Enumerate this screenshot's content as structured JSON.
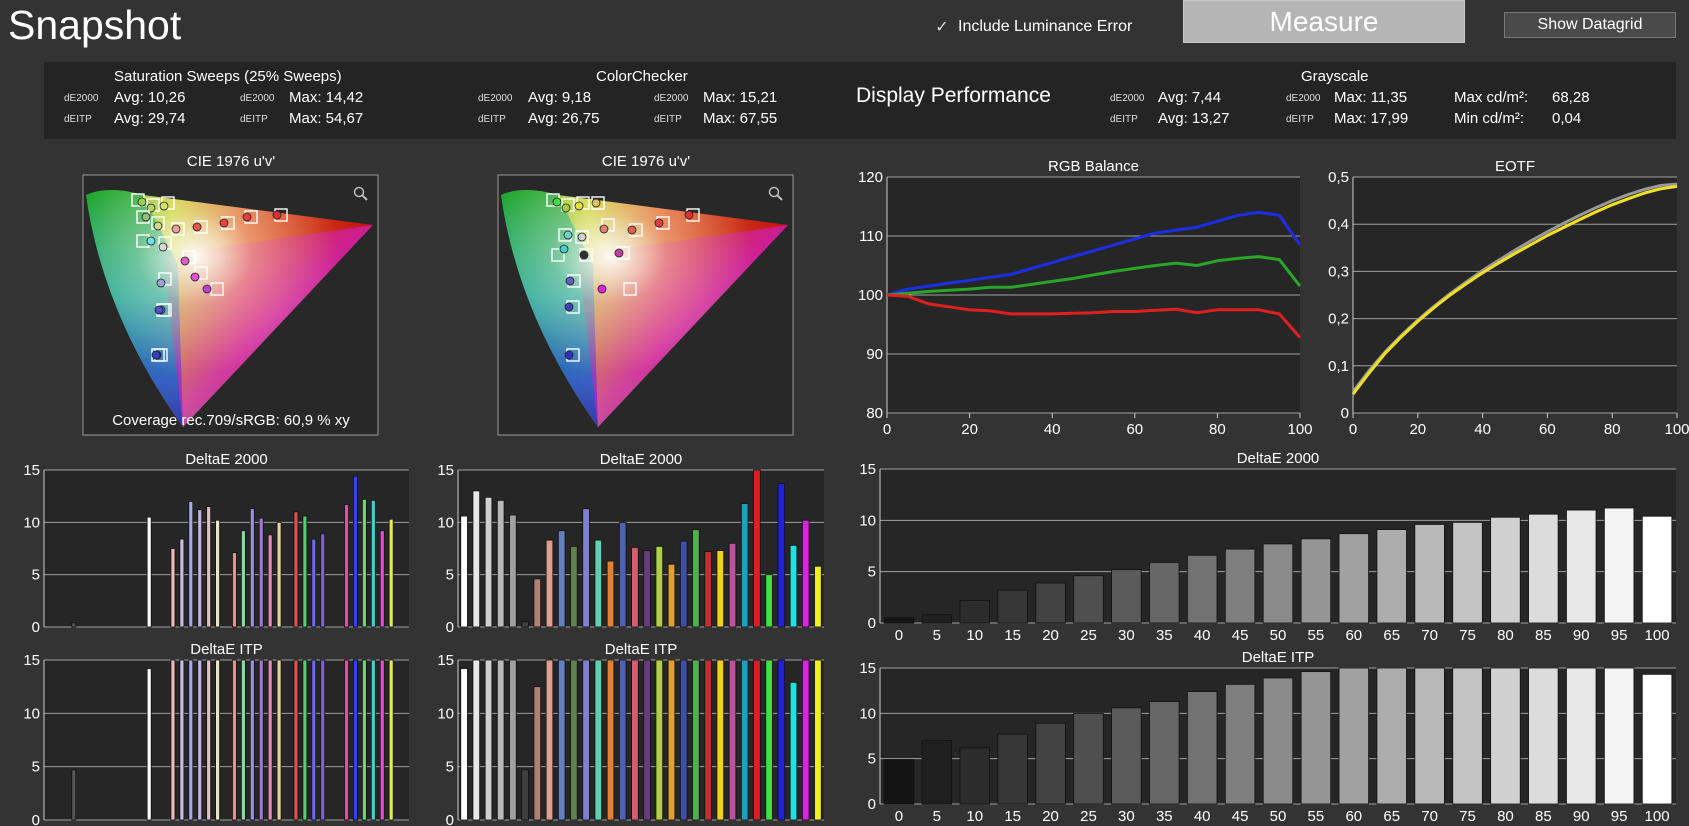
{
  "app": {
    "title": "Snapshot",
    "include_luminance_label": "Include Luminance Error",
    "measure_label": "Measure",
    "datagrid_label": "Show Datagrid",
    "checkmark": "✓",
    "checkbox_icon": "checkmark-icon"
  },
  "stats": {
    "saturation": {
      "title": "Saturation Sweeps (25% Sweeps)",
      "de2000_label": "dE2000",
      "deitp_label": "dEITP",
      "avg1": "Avg: 10,26",
      "max1": "Max: 14,42",
      "avg2": "Avg: 29,74",
      "max2": "Max: 54,67"
    },
    "colorchecker": {
      "title": "ColorChecker",
      "de2000_label": "dE2000",
      "deitp_label": "dEITP",
      "avg1": "Avg: 9,18",
      "max1": "Max: 15,21",
      "avg2": "Avg: 26,75",
      "max2": "Max: 67,55"
    },
    "display_performance": "Display Performance",
    "grayscale": {
      "title": "Grayscale",
      "de2000_label": "dE2000",
      "deitp_label": "dEITP",
      "avg1": "Avg: 7,44",
      "max1": "Max: 11,35",
      "avg2": "Avg: 13,27",
      "max2": "Max: 17,99",
      "maxcd_label": "Max cd/m²:",
      "maxcd": "68,28",
      "mincd_label": "Min cd/m²:",
      "mincd": "0,04"
    }
  },
  "cie": {
    "title": "CIE 1976 u'v'",
    "coverage": "Coverage rec.709/sRGB:  60,9 % xy",
    "zoom_icon": "magnifier-icon"
  },
  "chart_data": [
    {
      "type": "line",
      "title": "RGB Balance",
      "x": [
        0,
        5,
        10,
        15,
        20,
        25,
        30,
        35,
        40,
        45,
        50,
        55,
        60,
        65,
        70,
        75,
        80,
        85,
        90,
        95,
        100
      ],
      "ylim": [
        80,
        120
      ],
      "xlim": [
        0,
        100
      ],
      "yticks": [
        "80",
        "90",
        "100",
        "110",
        "120"
      ],
      "xticks": [
        "0",
        "20",
        "40",
        "60",
        "80",
        "100"
      ],
      "series": [
        {
          "color": "#1e2ee8",
          "values": [
            100,
            101,
            101.5,
            102,
            102.5,
            103,
            103.5,
            104.5,
            105.5,
            106.5,
            107.5,
            108.5,
            109.5,
            110.5,
            111,
            111.5,
            112.5,
            113.5,
            114,
            113.5,
            108.5
          ]
        },
        {
          "color": "#2aa52a",
          "values": [
            100,
            100.3,
            100.6,
            100.8,
            101,
            101.3,
            101.3,
            101.8,
            102.3,
            102.8,
            103.4,
            104,
            104.5,
            105,
            105.4,
            105,
            105.8,
            106.2,
            106.5,
            106,
            101.5
          ]
        },
        {
          "color": "#e02020",
          "values": [
            100,
            99.8,
            98.5,
            98,
            97.5,
            97.3,
            96.8,
            96.8,
            96.8,
            96.9,
            97,
            97.2,
            97.2,
            97.4,
            97.6,
            97,
            97.5,
            97.5,
            97.5,
            96.8,
            92.8
          ]
        }
      ]
    },
    {
      "type": "line",
      "title": "EOTF",
      "x": [
        0,
        5,
        10,
        15,
        20,
        25,
        30,
        35,
        40,
        45,
        50,
        55,
        60,
        65,
        70,
        75,
        80,
        85,
        90,
        95,
        100
      ],
      "ylim": [
        0,
        0.5
      ],
      "xlim": [
        0,
        100
      ],
      "yticks": [
        "0",
        "0,1",
        "0,2",
        "0,3",
        "0,4",
        "0,5"
      ],
      "xticks": [
        "0",
        "20",
        "40",
        "60",
        "80",
        "100"
      ],
      "series": [
        {
          "color": "#9a9a9a",
          "values": [
            0.045,
            0.09,
            0.13,
            0.165,
            0.197,
            0.226,
            0.253,
            0.278,
            0.302,
            0.324,
            0.345,
            0.365,
            0.384,
            0.402,
            0.419,
            0.435,
            0.45,
            0.463,
            0.474,
            0.482,
            0.485
          ]
        },
        {
          "color": "#f0e020",
          "values": [
            0.04,
            0.085,
            0.127,
            0.162,
            0.194,
            0.223,
            0.25,
            0.274,
            0.297,
            0.318,
            0.338,
            0.357,
            0.376,
            0.393,
            0.41,
            0.426,
            0.441,
            0.454,
            0.466,
            0.475,
            0.48
          ]
        }
      ]
    },
    {
      "type": "bar",
      "title": "DeltaE 2000",
      "subject": "saturation",
      "ylim": [
        0,
        15
      ],
      "yticks": [
        "0",
        "5",
        "10",
        "15"
      ],
      "values": [
        0.4,
        10.5,
        7.5,
        8.4,
        12,
        11.2,
        11.5,
        10.2,
        7.1,
        9.2,
        11.3,
        10.4,
        8.8,
        10,
        11,
        10.6,
        8.4,
        8.9,
        11.7,
        14.4,
        12.2,
        12.1,
        9.2,
        10.3
      ],
      "colors": [
        "#555555",
        "#ffffff",
        "#f0b8b8",
        "#c9bde6",
        "#a8a8e6",
        "#c7b3e6",
        "#e0bfc4",
        "#ece6c6",
        "#e89090",
        "#8fd6a0",
        "#9a8fe6",
        "#9e7ad6",
        "#e68ab6",
        "#e6d696",
        "#e05050",
        "#50d070",
        "#6a6af0",
        "#8060e0",
        "#e04fa0",
        "#3344ee",
        "#6ad96a",
        "#44d0d0",
        "#e050d0",
        "#e8e850"
      ]
    },
    {
      "type": "bar",
      "title": "DeltaE ITP",
      "subject": "saturation",
      "ylim": [
        0,
        15
      ],
      "yticks": [
        "0",
        "5",
        "10",
        "15"
      ],
      "values": [
        4.7,
        14.2,
        15,
        15,
        15,
        15,
        15,
        15,
        15,
        15,
        15,
        15,
        15,
        15,
        15,
        15,
        15,
        15,
        15,
        15,
        15,
        15,
        15,
        15
      ],
      "colors": [
        "#555555",
        "#ffffff",
        "#f0b8b8",
        "#c9bde6",
        "#a8a8e6",
        "#c7b3e6",
        "#e0bfc4",
        "#ece6c6",
        "#e89090",
        "#8fd6a0",
        "#9a8fe6",
        "#9e7ad6",
        "#e68ab6",
        "#e6d696",
        "#e05050",
        "#50d070",
        "#6a6af0",
        "#8060e0",
        "#e04fa0",
        "#3344ee",
        "#6ad96a",
        "#44d0d0",
        "#e050d0",
        "#e8e850"
      ]
    },
    {
      "type": "bar",
      "title": "DeltaE 2000",
      "subject": "colorchecker",
      "ylim": [
        0,
        15
      ],
      "yticks": [
        "0",
        "5",
        "10",
        "15"
      ],
      "values": [
        10.6,
        13,
        12.4,
        12.1,
        10.7,
        0.5,
        4.6,
        8.3,
        9.2,
        7.7,
        11.3,
        8.3,
        6.3,
        10,
        7.6,
        7.3,
        7.7,
        6,
        8.2,
        9.3,
        7.2,
        7.3,
        8,
        11.8,
        15.2,
        5,
        13.7,
        7.8,
        10.2,
        5.8
      ],
      "colors": [
        "#ffffff",
        "#e8e8e8",
        "#d0d0d0",
        "#b8b8b8",
        "#a0a0a0",
        "#404040",
        "#b08070",
        "#e0a090",
        "#6080c0",
        "#608050",
        "#8080d0",
        "#60d0b0",
        "#e08030",
        "#5060b0",
        "#d06070",
        "#6a3a80",
        "#b0d040",
        "#e0a030",
        "#4050a0",
        "#50b050",
        "#c03030",
        "#f0d020",
        "#c050a0",
        "#20a0c0",
        "#e02020",
        "#40e040",
        "#2020e0",
        "#20e0e0",
        "#e020e0",
        "#f0f020"
      ]
    },
    {
      "type": "bar",
      "title": "DeltaE ITP",
      "subject": "colorchecker",
      "ylim": [
        0,
        15
      ],
      "yticks": [
        "0",
        "5",
        "10",
        "15"
      ],
      "values": [
        14.2,
        15,
        15,
        15,
        15,
        4.7,
        12.5,
        15,
        15,
        15,
        15,
        15,
        15,
        15,
        15,
        15,
        15,
        15,
        15,
        15,
        15,
        15,
        15,
        15,
        15,
        15,
        15,
        12.9,
        15,
        15
      ],
      "colors": [
        "#ffffff",
        "#e8e8e8",
        "#d0d0d0",
        "#b8b8b8",
        "#a0a0a0",
        "#404040",
        "#b08070",
        "#e0a090",
        "#6080c0",
        "#608050",
        "#8080d0",
        "#60d0b0",
        "#e08030",
        "#5060b0",
        "#d06070",
        "#6a3a80",
        "#b0d040",
        "#e0a030",
        "#4050a0",
        "#50b050",
        "#c03030",
        "#f0d020",
        "#c050a0",
        "#20a0c0",
        "#e02020",
        "#40e040",
        "#2020e0",
        "#20e0e0",
        "#e020e0",
        "#f0f020"
      ]
    },
    {
      "type": "bar",
      "title": "DeltaE 2000",
      "subject": "grayscale",
      "ylim": [
        0,
        15
      ],
      "yticks": [
        "0",
        "5",
        "10",
        "15"
      ],
      "categories": [
        "0",
        "5",
        "10",
        "15",
        "20",
        "25",
        "30",
        "35",
        "40",
        "45",
        "50",
        "55",
        "60",
        "65",
        "70",
        "75",
        "80",
        "85",
        "90",
        "95",
        "100"
      ],
      "values": [
        0.5,
        0.8,
        2.2,
        3.2,
        3.9,
        4.6,
        5.2,
        5.9,
        6.6,
        7.2,
        7.7,
        8.2,
        8.7,
        9.1,
        9.6,
        9.8,
        10.3,
        10.6,
        11,
        11.2,
        10.4
      ]
    },
    {
      "type": "bar",
      "title": "DeltaE ITP",
      "subject": "grayscale",
      "ylim": [
        0,
        15
      ],
      "yticks": [
        "0",
        "5",
        "10",
        "15"
      ],
      "categories": [
        "0",
        "5",
        "10",
        "15",
        "20",
        "25",
        "30",
        "35",
        "40",
        "45",
        "50",
        "55",
        "60",
        "65",
        "70",
        "75",
        "80",
        "85",
        "90",
        "95",
        "100"
      ],
      "values": [
        4.9,
        7,
        6.2,
        7.7,
        8.9,
        10,
        10.6,
        11.3,
        12.4,
        13.2,
        13.9,
        14.6,
        15,
        15,
        15,
        15,
        15,
        15,
        15,
        15,
        14.3
      ]
    }
  ]
}
